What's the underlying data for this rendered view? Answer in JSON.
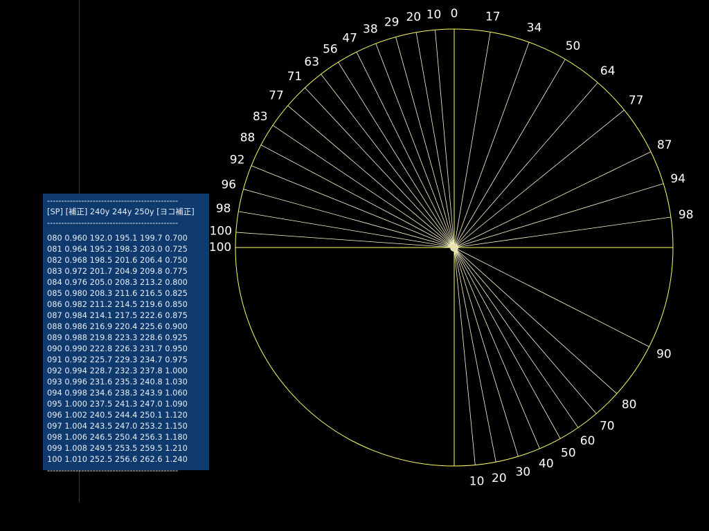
{
  "panel": {
    "dash_line": "----------------------------------------------",
    "header": "[SP] [補正] 240y 244y 250y [ヨコ補正]",
    "rows": [
      "080 0.960 192.0 195.1 199.7 0.700",
      "081 0.964 195.2 198.3 203.0 0.725",
      "082 0.968 198.5 201.6 206.4 0.750",
      "083 0.972 201.7 204.9 209.8 0.775",
      "084 0.976 205.0 208.3 213.2 0.800",
      "085 0.980 208.3 211.6 216.5 0.825",
      "086 0.982 211.2 214.5 219.6 0.850",
      "087 0.984 214.1 217.5 222.6 0.875",
      "088 0.986 216.9 220.4 225.6 0.900",
      "089 0.988 219.8 223.3 228.6 0.925",
      "090 0.990 222.8 226.3 231.7 0.950",
      "091 0.992 225.7 229.3 234.7 0.975",
      "092 0.994 228.7 232.3 237.8 1.000",
      "093 0.996 231.6 235.3 240.8 1.030",
      "094 0.998 234.6 238.3 243.9 1.060",
      "095 1.000 237.5 241.3 247.0 1.090",
      "096 1.002 240.5 244.4 250.1 1.120",
      "097 1.004 243.5 247.0 253.2 1.150",
      "098 1.006 246.5 250.4 256.3 1.180",
      "099 1.008 249.5 253.5 259.5 1.210",
      "100 1.010 252.5 256.6 262.6 1.240"
    ]
  },
  "dial": {
    "colors": {
      "line": "#ffff66",
      "spoke": "#fffbd0",
      "text": "#ffffff"
    },
    "upper_left_labels": [
      "0",
      "10",
      "20",
      "29",
      "38",
      "47",
      "56",
      "63",
      "71",
      "77",
      "83",
      "88",
      "92",
      "96",
      "98",
      "100",
      "100"
    ],
    "upper_right_labels": [
      "17",
      "34",
      "50",
      "64",
      "77",
      "87",
      "94",
      "98"
    ],
    "lower_labels": [
      "10",
      "20",
      "30",
      "40",
      "50",
      "60",
      "70",
      "80",
      "90"
    ]
  }
}
